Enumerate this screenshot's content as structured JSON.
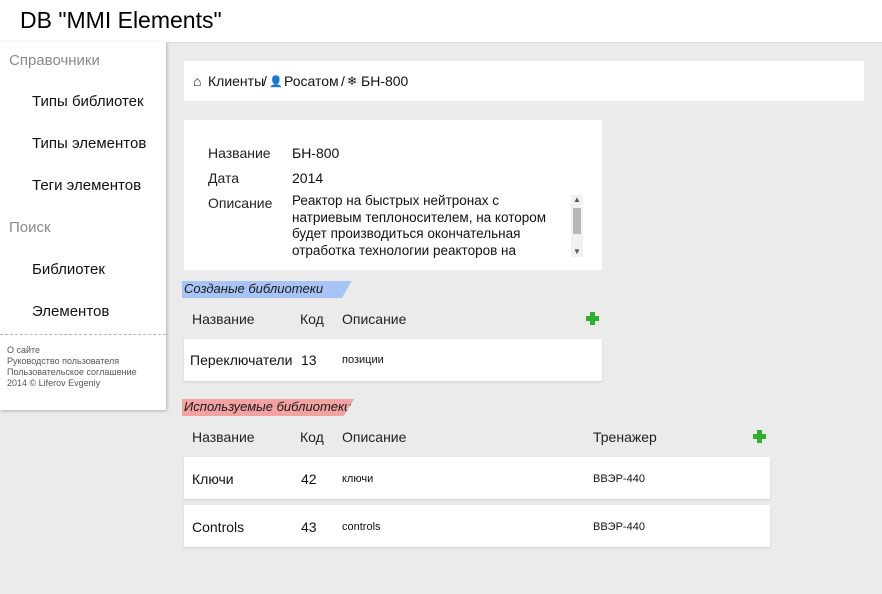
{
  "app_title": "DB \"MMI Elements\"",
  "sidebar": {
    "reference_heading": "Справочники",
    "reference_items": [
      "Типы библиотек",
      "Типы элементов",
      "Теги элементов"
    ],
    "search_heading": "Поиск",
    "search_items": [
      "Библиотек",
      "Элементов"
    ],
    "footer": [
      "О сайте",
      "Руководство пользователя",
      "Пользовательское соглашение",
      "2014 © Liferov Evgeniy"
    ]
  },
  "breadcrumb": {
    "home_icon": "⌂",
    "clients": "Клиенты",
    "sep1": "/",
    "user_icon": "👤",
    "client": "Росатом",
    "sep2": "/",
    "reactor_icon": "❄",
    "current": "БН-800"
  },
  "info": {
    "name_label": "Название",
    "name_value": "БН-800",
    "date_label": "Дата",
    "date_value": "2014",
    "desc_label": "Описание",
    "desc_value": "Реактор на быстрых нейтронах с натриевым теплоносителем, на котором будет производиться окончательная отработка технологии реакторов на быстрых нейтронах"
  },
  "created_libraries": {
    "title": "Созданые библиотеки",
    "headers": {
      "name": "Название",
      "code": "Код",
      "desc": "Описание"
    },
    "add_icon": "plus-icon",
    "rows": [
      {
        "name": "Переключатели",
        "code": "13",
        "desc": "позиции"
      }
    ]
  },
  "used_libraries": {
    "title": "Используемые библиотеки",
    "headers": {
      "name": "Название",
      "code": "Код",
      "desc": "Описание",
      "trainer": "Тренажер"
    },
    "add_icon": "plus-icon",
    "rows": [
      {
        "name": "Ключи",
        "code": "42",
        "desc": "ключи",
        "trainer": "ВВЭР-440"
      },
      {
        "name": "Controls",
        "code": "43",
        "desc": "controls",
        "trainer": "ВВЭР-440"
      }
    ]
  },
  "colors": {
    "created_accent": "#a8c4f5",
    "used_accent": "#f3a2a2",
    "add_green": "#2fae2f"
  }
}
